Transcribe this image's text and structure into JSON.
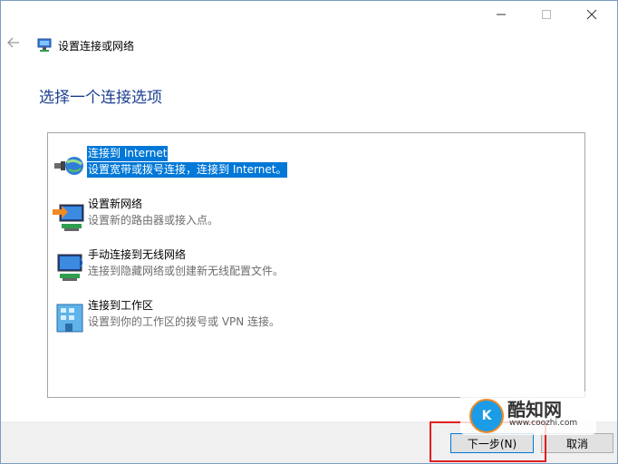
{
  "titlebar": {
    "minimize_icon": "minimize-icon",
    "maximize_icon": "maximize-icon",
    "close_icon": "close-icon"
  },
  "header": {
    "title": "设置连接或网络",
    "back_icon": "back-arrow-icon"
  },
  "page": {
    "heading": "选择一个连接选项"
  },
  "options": [
    {
      "title": "连接到 Internet",
      "desc": "设置宽带或拨号连接，连接到 Internet。",
      "icon": "globe-icon",
      "selected": true
    },
    {
      "title": "设置新网络",
      "desc": "设置新的路由器或接入点。",
      "icon": "new-network-icon",
      "selected": false
    },
    {
      "title": "手动连接到无线网络",
      "desc": "连接到隐藏网络或创建新无线配置文件。",
      "icon": "wireless-network-icon",
      "selected": false
    },
    {
      "title": "连接到工作区",
      "desc": "设置到你的工作区的拨号或 VPN 连接。",
      "icon": "workplace-icon",
      "selected": false
    }
  ],
  "footer": {
    "next_label": "下一步(N)",
    "cancel_label": "取消"
  },
  "watermark": {
    "logo_text": "K",
    "title": "酷知网",
    "url": "www.coozhi.com"
  },
  "colors": {
    "selection": "#0078d7",
    "heading": "#1d3f91",
    "highlight_frame": "#e02020"
  }
}
